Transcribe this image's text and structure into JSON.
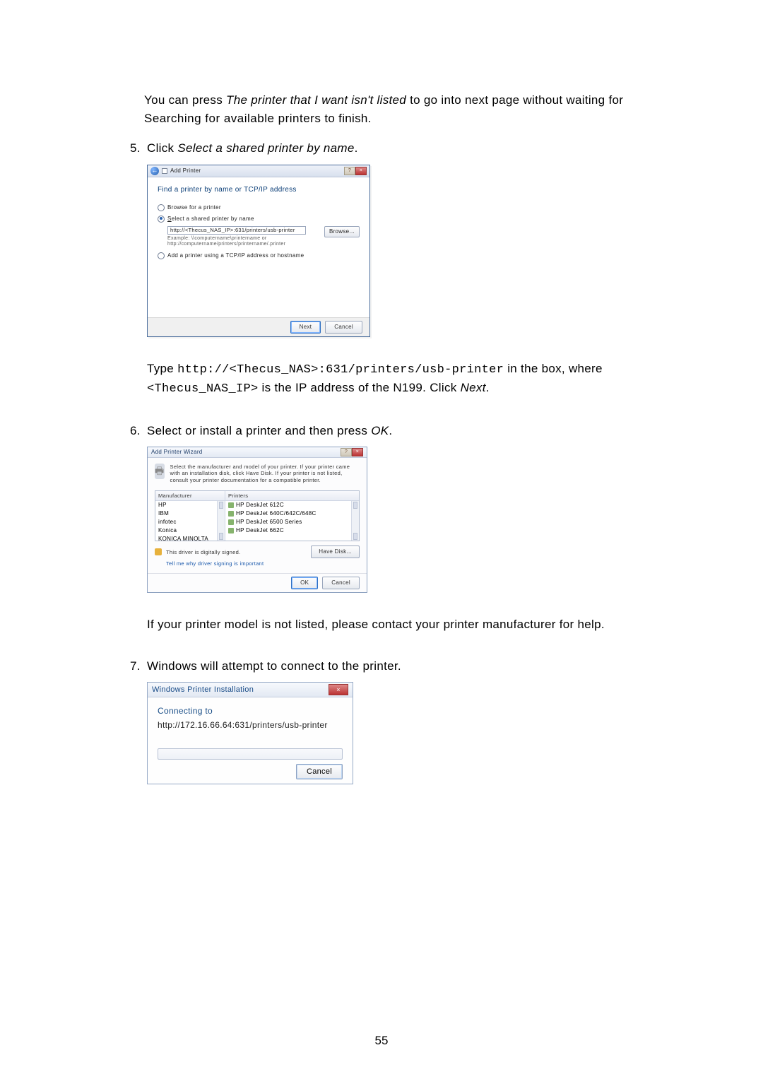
{
  "intro": {
    "pre": "You can press ",
    "em": "The printer that I want isn't listed",
    "post1": " to go into next page without waiting for ",
    "bold": "Searching for available printers",
    "post2": " to finish."
  },
  "step5": {
    "num": "5.",
    "pre": "Click ",
    "em": "Select a shared printer by name",
    "post": "."
  },
  "fig1": {
    "title": "Add Printer",
    "heading": "Find a printer by name or TCP/IP address",
    "radio_browse": "Browse for a printer",
    "radio_select": "Select a shared printer by name",
    "input_value": "http://<Thecus_NAS_IP>:631/printers/usb-printer",
    "browse": "Browse...",
    "example1": "Example: \\\\computername\\printername or",
    "example2": "http://computername/printers/printername/.printer",
    "radio_tcp": "Add a printer using a TCP/IP address or hostname",
    "next": "Next",
    "cancel": "Cancel"
  },
  "after5": {
    "t1": "Type ",
    "code": "http://<Thecus_NAS>:631/printers/usb-printer",
    "t2": " in the box, where ",
    "code2": "<Thecus_NAS_IP>",
    "t3": " is the IP address of the N199. Click ",
    "em": "Next",
    "t4": "."
  },
  "step6": {
    "num": "6.",
    "t1": "Select or install a printer and then press ",
    "em": "OK",
    "t2": "."
  },
  "fig2": {
    "title": "Add Printer Wizard",
    "instr": "Select the manufacturer and model of your printer. If your printer came with an installation disk, click Have Disk. If your printer is not listed, consult your printer documentation for a compatible printer.",
    "col_manu": "Manufacturer",
    "col_prn": "Printers",
    "manu": [
      "HP",
      "IBM",
      "infotec",
      "Konica",
      "KONICA MINOLTA"
    ],
    "prn": [
      "HP DeskJet 612C",
      "HP DeskJet 640C/642C/648C",
      "HP DeskJet 6500 Series",
      "HP DeskJet 662C"
    ],
    "signed": "This driver is digitally signed.",
    "tell": "Tell me why driver signing is important",
    "have_disk": "Have Disk...",
    "ok": "OK",
    "cancel": "Cancel"
  },
  "after6": "If your printer model is not listed, please contact your printer manufacturer for help.",
  "step7": {
    "num": "7.",
    "text": "Windows will attempt to connect to the printer."
  },
  "fig3": {
    "title": "Windows Printer Installation",
    "connecting": "Connecting to",
    "url": "http://172.16.66.64:631/printers/usb-printer",
    "cancel": "Cancel"
  },
  "page_number": "55"
}
